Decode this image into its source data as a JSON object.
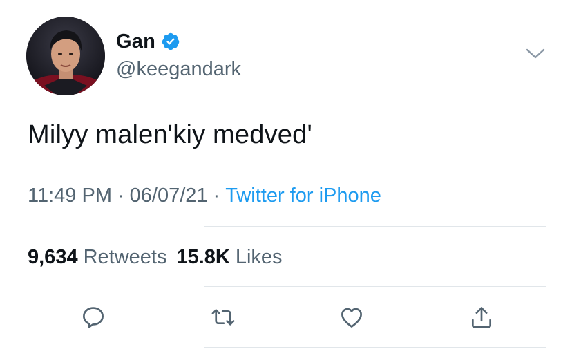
{
  "author": {
    "display_name": "Gan",
    "handle": "@keegandark",
    "verified": true
  },
  "tweet": {
    "text": "Milyy malen'kiy medved'",
    "time": "11:49 PM",
    "date": "06/07/21",
    "source": "Twitter for iPhone",
    "separator": "·"
  },
  "stats": {
    "retweets_count": "9,634",
    "retweets_label": "Retweets",
    "likes_count": "15.8K",
    "likes_label": "Likes"
  },
  "colors": {
    "text": "#0f1419",
    "secondary": "#536471",
    "accent": "#1d9bf0"
  },
  "icons": {
    "reply": "comment-icon",
    "retweet": "retweet-icon",
    "like": "heart-icon",
    "share": "share-icon",
    "menu": "chevron-down-icon",
    "verified": "verified-badge-icon"
  }
}
